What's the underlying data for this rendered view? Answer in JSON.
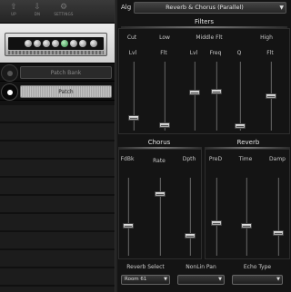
{
  "toolbar": {
    "buttons": [
      {
        "icon": "arrow-up-icon",
        "glyph": "⇧",
        "label": "UP"
      },
      {
        "icon": "arrow-down-icon",
        "glyph": "⇩",
        "label": "DN"
      },
      {
        "icon": "gear-icon",
        "glyph": "⚙",
        "label": "SETTINGS"
      }
    ]
  },
  "chain": {
    "items": [
      {
        "label": "Patch Bank",
        "active": false
      },
      {
        "label": "Patch",
        "active": true
      }
    ]
  },
  "algorithm": {
    "label": "Alg",
    "value": "Reverb & Chorus (Parallel)",
    "arrow": "▼"
  },
  "filters": {
    "title": "Filters",
    "group_labels": {
      "low": "Low",
      "mid": "Middle Flt",
      "high": "High"
    },
    "cut_label": "Cut",
    "columns": [
      {
        "label": "Lvl",
        "value": 0.18
      },
      {
        "label": "Flt",
        "value": 0.08
      },
      {
        "label": "Lvl",
        "value": 0.55
      },
      {
        "label": "Freq",
        "value": 0.57
      },
      {
        "label": "Q",
        "value": 0.07
      },
      {
        "label": "Flt",
        "value": 0.5
      }
    ]
  },
  "chorus": {
    "title": "Chorus",
    "columns": [
      {
        "label": "FdBk",
        "value": 0.38
      },
      {
        "label": "Rate",
        "value": 0.79
      },
      {
        "label": "Dpth",
        "value": 0.26
      }
    ]
  },
  "reverb": {
    "title": "Reverb",
    "columns": [
      {
        "label": "PreD",
        "value": 0.42
      },
      {
        "label": "Time",
        "value": 0.38
      },
      {
        "label": "Damp",
        "value": 0.29
      }
    ]
  },
  "bottom": {
    "reverb_select": {
      "label": "Reverb Select",
      "value": "Room 61",
      "arrow": "▼"
    },
    "nonlin_pan": {
      "label": "NonLin Pan",
      "value": "",
      "arrow": "▼"
    },
    "echo_type": {
      "label": "Echo Type",
      "value": "",
      "arrow": "▼"
    }
  }
}
